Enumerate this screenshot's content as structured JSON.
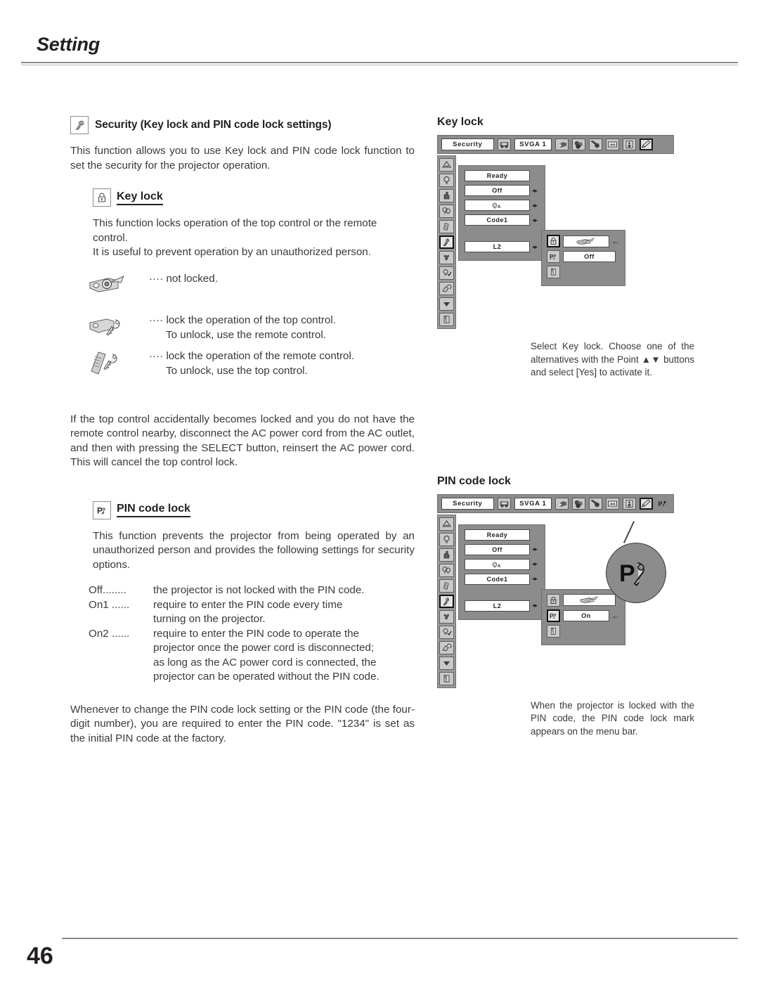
{
  "header": {
    "title": "Setting"
  },
  "footer": {
    "page_number": "46"
  },
  "security": {
    "icon": "key-icon",
    "heading": "Security (Key lock and PIN code lock settings)",
    "intro": "This function allows you to use Key lock and PIN code lock function to set the security for the projector operation."
  },
  "key_lock": {
    "icon": "padlock-icon",
    "heading": "Key lock",
    "intro_line1": "This function locks operation of the top control or the remote control.",
    "intro_line2": "It is useful to prevent operation by an unauthorized person.",
    "options": [
      {
        "icon": "projector-key-unlocked-icon",
        "dots": "····",
        "text": "not locked.",
        "sub": ""
      },
      {
        "icon": "projector-key-locked-icon",
        "dots": "····",
        "text": "lock the operation of the top control.",
        "sub": "To unlock, use the remote control."
      },
      {
        "icon": "remote-key-locked-icon",
        "dots": "····",
        "text": "lock the operation of the remote control.",
        "sub": "To unlock, use the top control."
      }
    ],
    "note": "If the top control accidentally becomes locked and you do not have the remote control nearby, disconnect the AC power cord from the AC outlet, and then with pressing the SELECT button, reinsert the AC power cord.  This will cancel the top control lock."
  },
  "pin_code_lock": {
    "icon": "pin-code-icon",
    "heading": "PIN code lock",
    "intro": "This function prevents the projector from being operated by an unauthorized person and provides the following settings for security options.",
    "settings": [
      {
        "term": "Off........",
        "desc": "the projector is not locked with the PIN code.",
        "cont": []
      },
      {
        "term": "On1 ......",
        "desc": "require to enter the PIN code every time",
        "cont": [
          "turning on the projector."
        ]
      },
      {
        "term": "On2 ......",
        "desc": "require to enter the PIN code to operate the",
        "cont": [
          "projector once the power cord is disconnected;",
          "as long as the AC power cord is connected, the",
          "projector can be operated without the PIN code."
        ]
      }
    ],
    "note": "Whenever to change the PIN code lock setting or the PIN code (the four-digit number), you are required to enter the PIN code.  \"1234\" is set as the initial PIN code at the factory."
  },
  "figures": [
    {
      "title": "Key lock",
      "menu_bar": {
        "menu_name": "Security",
        "source_icon": "input-source-icon",
        "source_name": "SVGA 1",
        "category_icons": [
          "image-select-icon",
          "image-adjust-icon",
          "pc-adjust-icon",
          "screen-icon",
          "sound-icon",
          "setting-icon"
        ],
        "selected_category": "setting-icon",
        "pin_mark": false
      },
      "side_icons": [
        "keystone-icon",
        "lamp-icon",
        "power-management-icon",
        "lamp-control-icon",
        "remote-icon",
        "security-icon",
        "fan-icon",
        "lamp-counter-icon",
        "filter-counter-icon",
        "next-page-icon",
        "quit-icon"
      ],
      "selected_side_icon": "security-icon",
      "rows": [
        {
          "value": "Ready",
          "arrows": false,
          "gap": false
        },
        {
          "value": "Off",
          "arrows": true,
          "gap": false
        },
        {
          "value": "lamp-auto-icon",
          "arrows": true,
          "gap": false,
          "is_icon": true
        },
        {
          "value": "Code1",
          "arrows": true,
          "gap": false
        },
        {
          "value": "L2",
          "arrows": true,
          "gap": true
        }
      ],
      "submenu": {
        "rows": [
          {
            "icon": "padlock-icon",
            "value": "projector-key-unlocked-icon",
            "is_icon": true,
            "selected": true,
            "arrow": true
          },
          {
            "icon": "pin-code-icon",
            "value": "Off",
            "is_icon": false,
            "selected": false,
            "arrow": false
          },
          {
            "icon": "quit-icon",
            "value": "",
            "is_icon": false,
            "selected": false,
            "arrow": false
          }
        ]
      },
      "caption": "Select Key lock.  Choose one of the alternatives with the Point ▲▼ buttons and select [Yes] to activate it."
    },
    {
      "title": "PIN code lock",
      "menu_bar": {
        "menu_name": "Security",
        "source_icon": "input-source-icon",
        "source_name": "SVGA 1",
        "category_icons": [
          "image-select-icon",
          "image-adjust-icon",
          "pc-adjust-icon",
          "screen-icon",
          "sound-icon",
          "setting-icon"
        ],
        "selected_category": "setting-icon",
        "pin_mark": true
      },
      "side_icons": [
        "keystone-icon",
        "lamp-icon",
        "power-management-icon",
        "lamp-control-icon",
        "remote-icon",
        "security-icon",
        "fan-icon",
        "lamp-counter-icon",
        "filter-counter-icon",
        "next-page-icon",
        "quit-icon"
      ],
      "selected_side_icon": "security-icon",
      "rows": [
        {
          "value": "Ready",
          "arrows": false,
          "gap": false
        },
        {
          "value": "Off",
          "arrows": true,
          "gap": false
        },
        {
          "value": "lamp-auto-icon",
          "arrows": true,
          "gap": false,
          "is_icon": true
        },
        {
          "value": "Code1",
          "arrows": true,
          "gap": false
        },
        {
          "value": "L2",
          "arrows": true,
          "gap": true
        }
      ],
      "submenu": {
        "rows": [
          {
            "icon": "padlock-icon",
            "value": "projector-key-unlocked-icon",
            "is_icon": true,
            "selected": false,
            "arrow": false
          },
          {
            "icon": "pin-code-icon",
            "value": "On",
            "is_icon": false,
            "selected": true,
            "arrow": true
          },
          {
            "icon": "quit-icon",
            "value": "",
            "is_icon": false,
            "selected": false,
            "arrow": false
          }
        ]
      },
      "caption": "When the projector is locked with the PIN code, the PIN code lock mark appears on the menu bar."
    }
  ]
}
